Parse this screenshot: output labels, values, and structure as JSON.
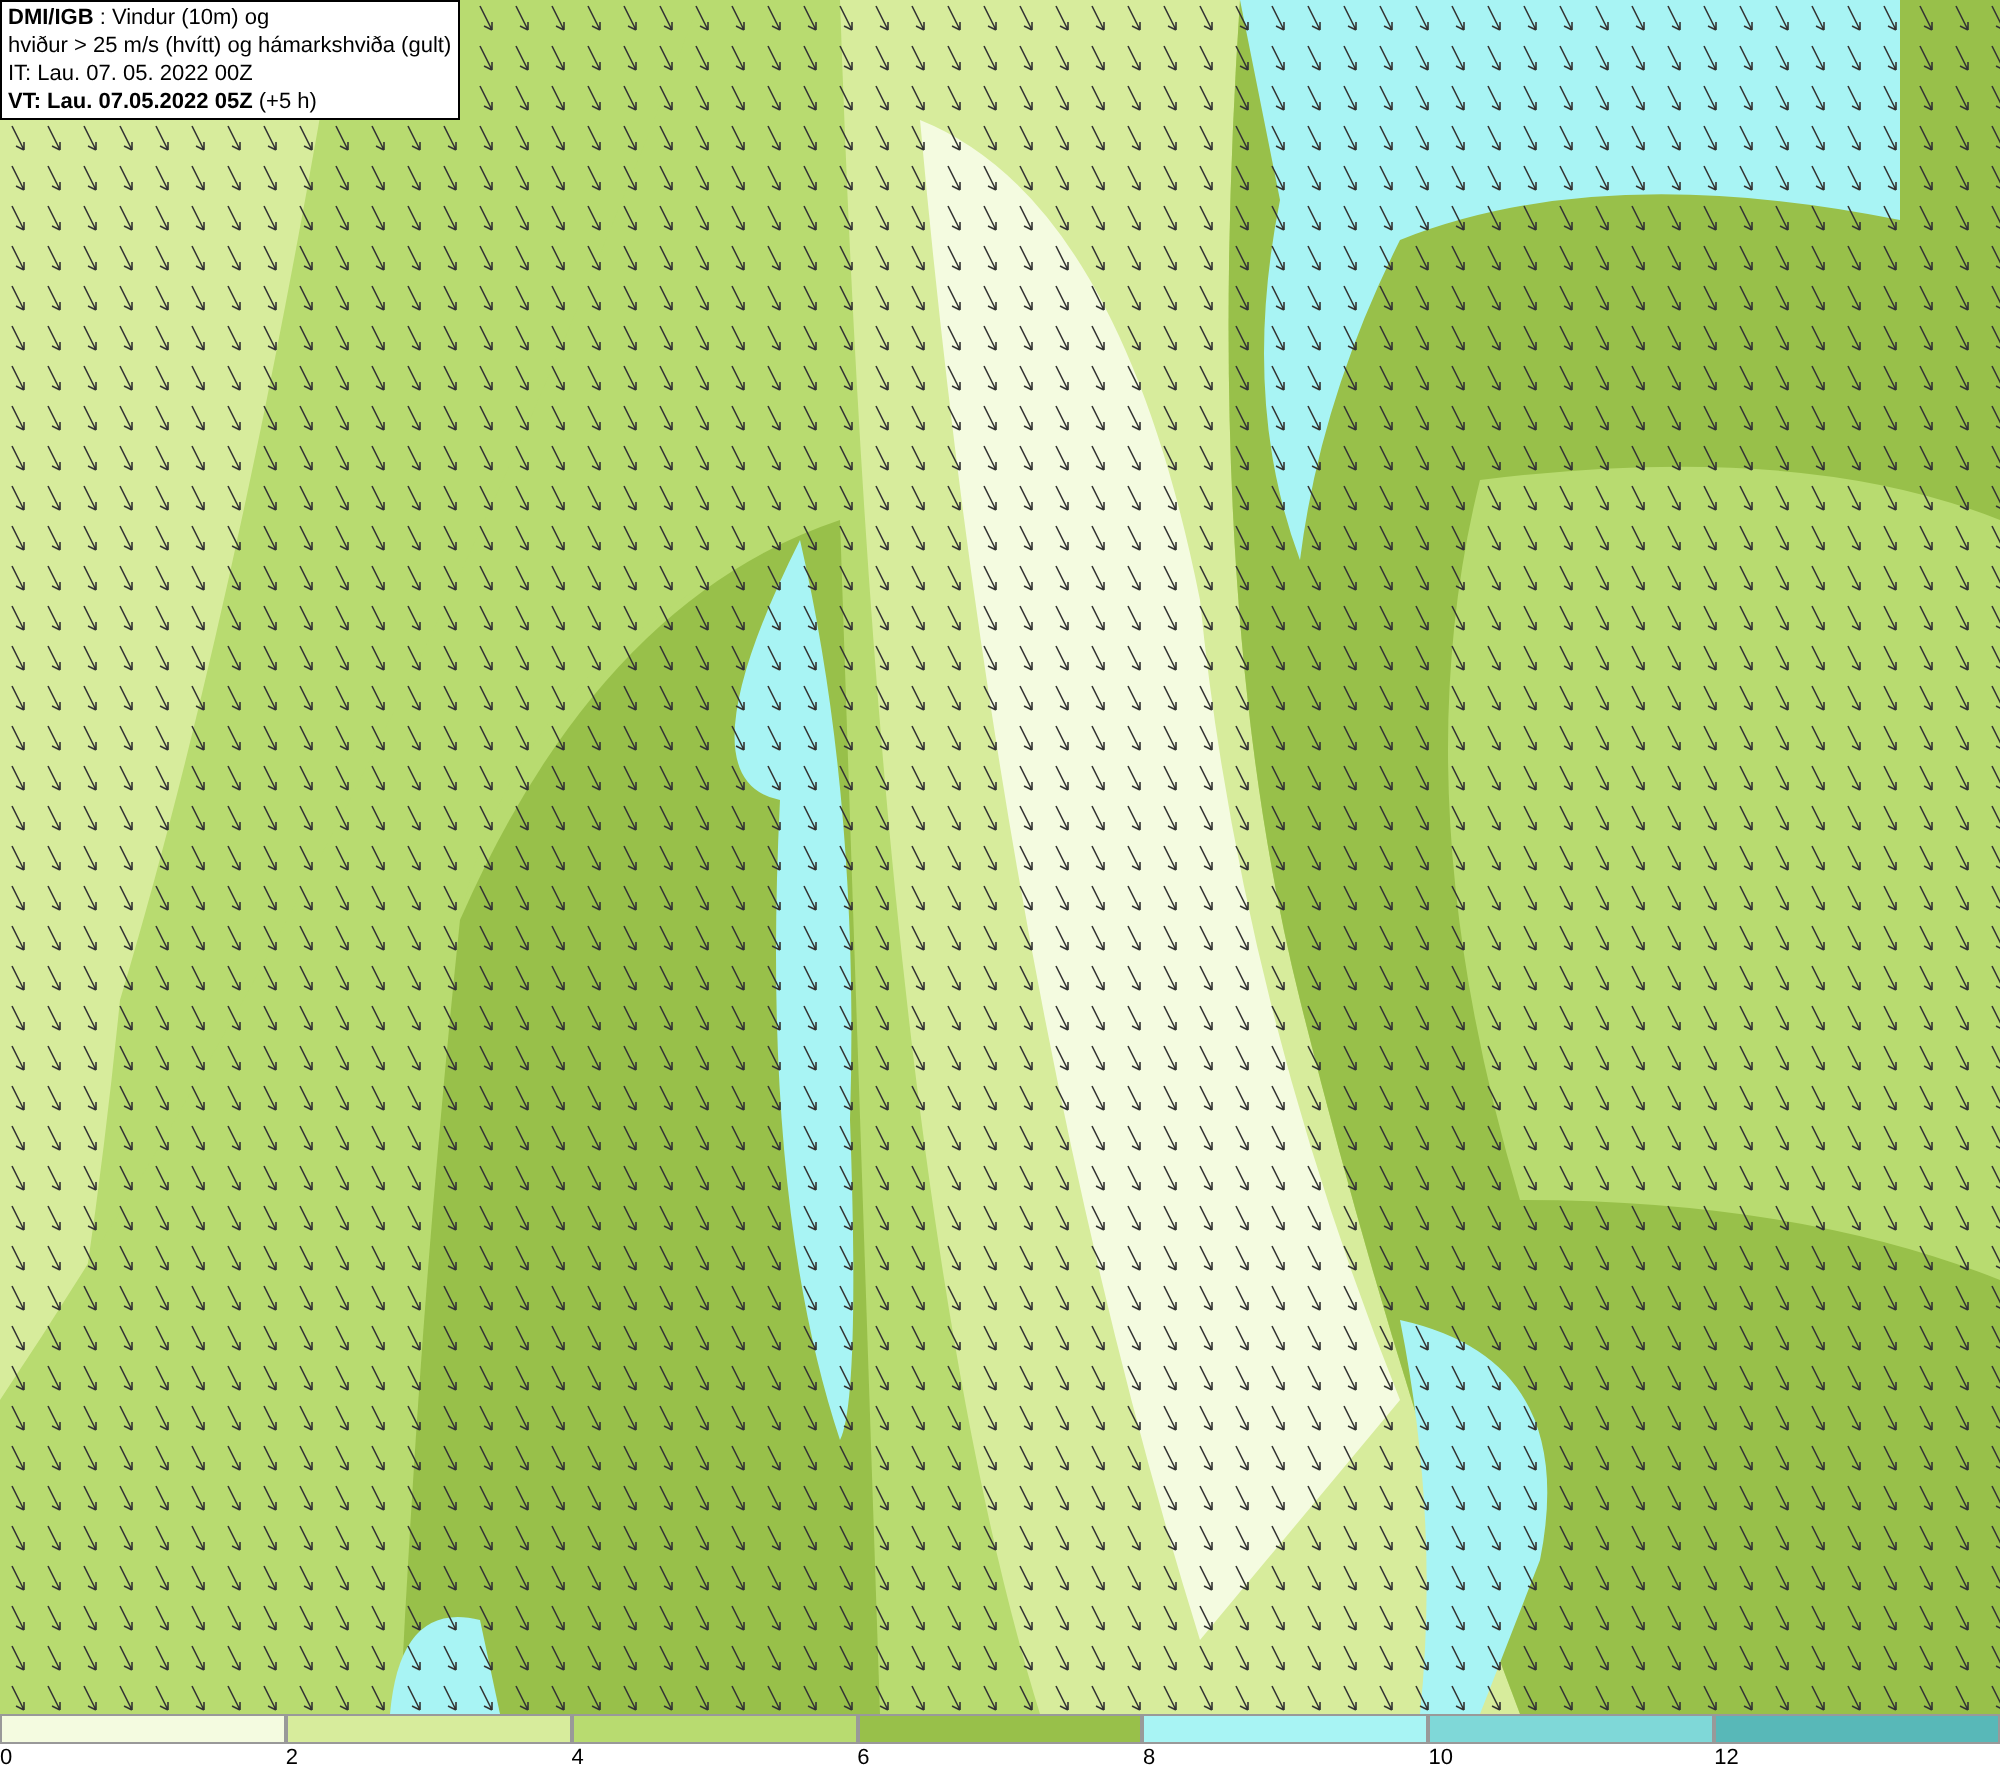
{
  "info_box": {
    "lines": [
      "**DMI/IGB** : Vindur (10m) og",
      "hviður > 25 m/s (hvítt) og hámarkshviða (gult)",
      "IT: Lau. 07. 05. 2022 00Z",
      "**VT: Lau. 07.05.2022 05Z** (+5 h)"
    ]
  },
  "legend": [
    {
      "label": "0",
      "color": "#f4fbe0"
    },
    {
      "label": "2",
      "color": "#d7ec9c"
    },
    {
      "label": "4",
      "color": "#b8db70"
    },
    {
      "label": "6",
      "color": "#98c04a"
    },
    {
      "label": "8",
      "color": "#a8f4f4"
    },
    {
      "label": "10",
      "color": "#7fd8d8"
    },
    {
      "label": "12",
      "color": "#58b8b8"
    }
  ]
}
